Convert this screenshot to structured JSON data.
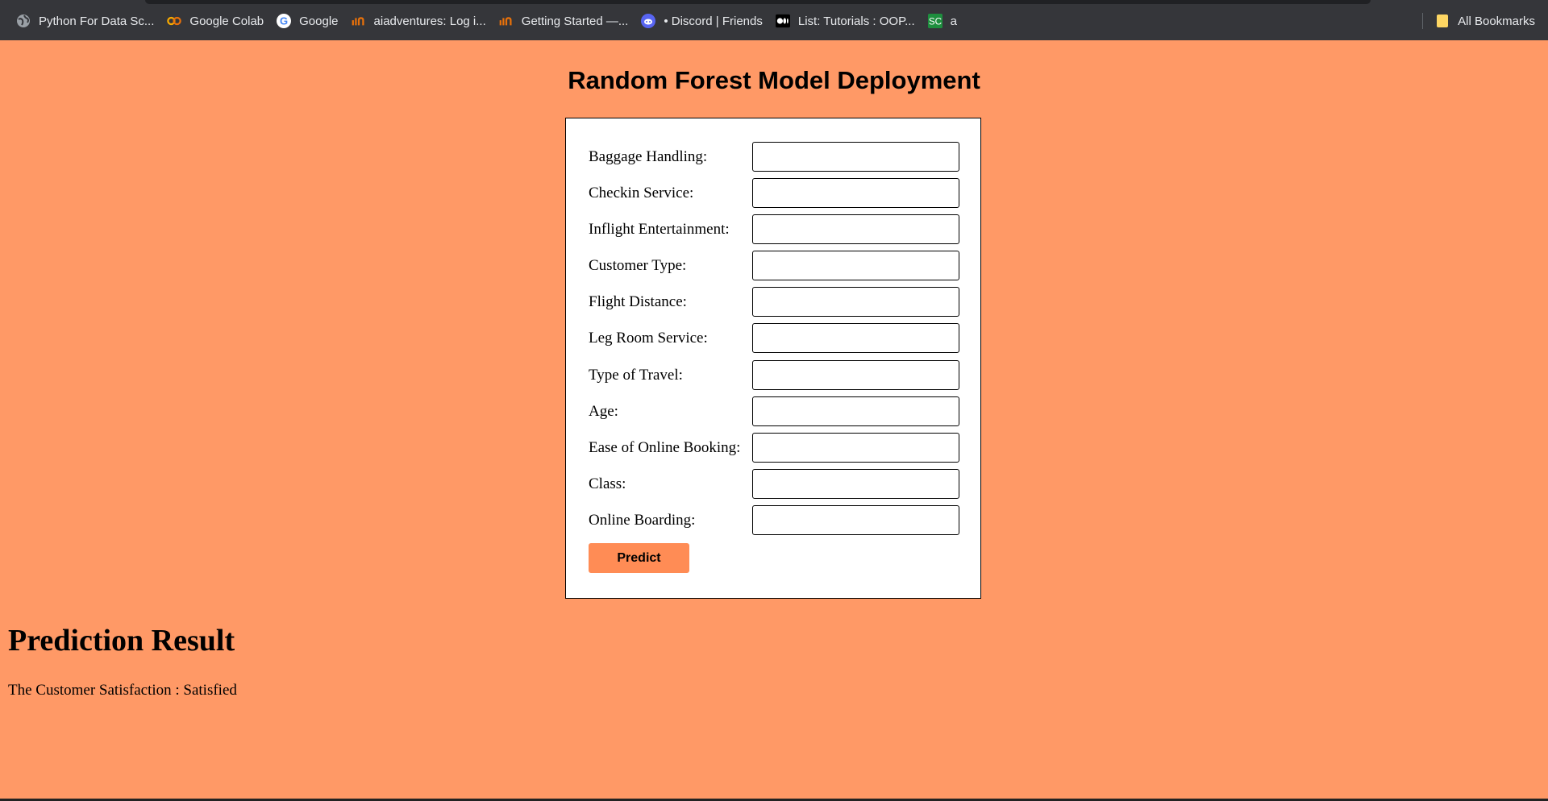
{
  "bookmarks": {
    "items": [
      {
        "label": "Python For Data Sc...",
        "icon": "globe-icon"
      },
      {
        "label": "Google Colab",
        "icon": "colab-icon"
      },
      {
        "label": "Google",
        "icon": "google-icon"
      },
      {
        "label": "aiadventures: Log i...",
        "icon": "aiadventures-icon"
      },
      {
        "label": "Getting Started —...",
        "icon": "aiadventures-icon"
      },
      {
        "label": "• Discord | Friends",
        "icon": "discord-icon"
      },
      {
        "label": "List: Tutorials : OOP...",
        "icon": "medium-icon"
      },
      {
        "label": "a",
        "icon": "sc-icon",
        "icon_text": "SC"
      }
    ],
    "all_bookmarks_label": "All Bookmarks"
  },
  "page": {
    "title": "Random Forest Model Deployment"
  },
  "form": {
    "fields": [
      {
        "label": "Baggage Handling:",
        "value": ""
      },
      {
        "label": "Checkin Service:",
        "value": ""
      },
      {
        "label": "Inflight Entertainment:",
        "value": ""
      },
      {
        "label": "Customer Type:",
        "value": ""
      },
      {
        "label": "Flight Distance:",
        "value": ""
      },
      {
        "label": "Leg Room Service:",
        "value": ""
      },
      {
        "label": "Type of Travel:",
        "value": ""
      },
      {
        "label": "Age:",
        "value": ""
      },
      {
        "label": "Ease of Online Booking:",
        "value": ""
      },
      {
        "label": "Class:",
        "value": ""
      },
      {
        "label": "Online Boarding:",
        "value": ""
      }
    ],
    "submit_label": "Predict"
  },
  "result": {
    "heading": "Prediction Result",
    "text": "The Customer Satisfaction : Satisfied"
  },
  "colors": {
    "page_background": "#ff9966",
    "button_background": "#ff8c55",
    "toolbar_background": "#35363a"
  }
}
